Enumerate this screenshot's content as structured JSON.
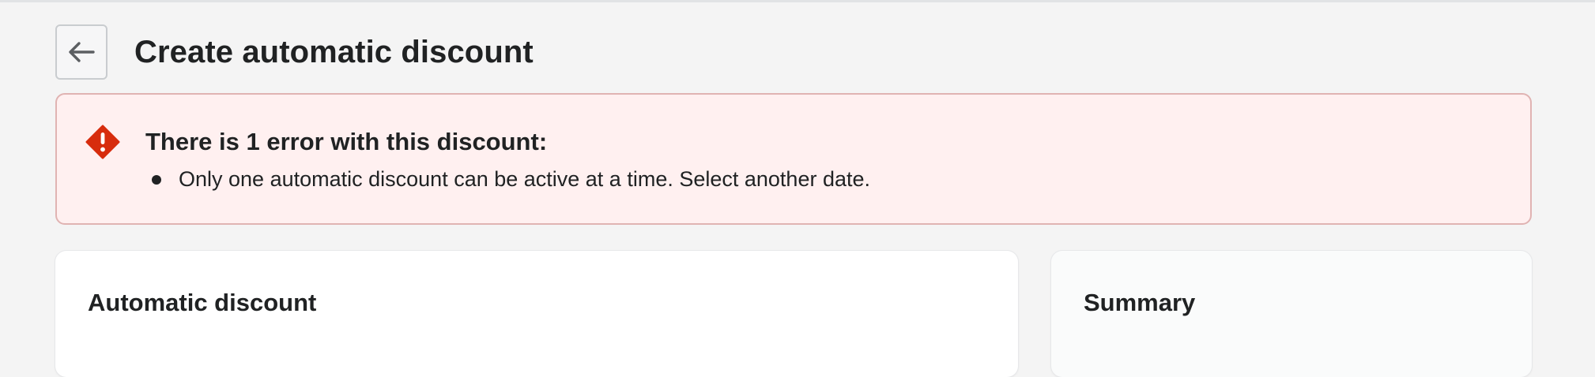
{
  "header": {
    "back_label": "Back",
    "title": "Create automatic discount"
  },
  "error_banner": {
    "icon": "error-diamond-icon",
    "title": "There is 1 error with this discount:",
    "errors": [
      "Only one automatic discount can be active at a time. Select another date."
    ]
  },
  "main_card": {
    "title": "Automatic discount"
  },
  "summary_card": {
    "title": "Summary"
  },
  "colors": {
    "background": "#f4f4f4",
    "banner_background": "#fff0f0",
    "banner_border": "#e0b3b2",
    "critical_icon": "#d72c0d",
    "text": "#202223"
  }
}
